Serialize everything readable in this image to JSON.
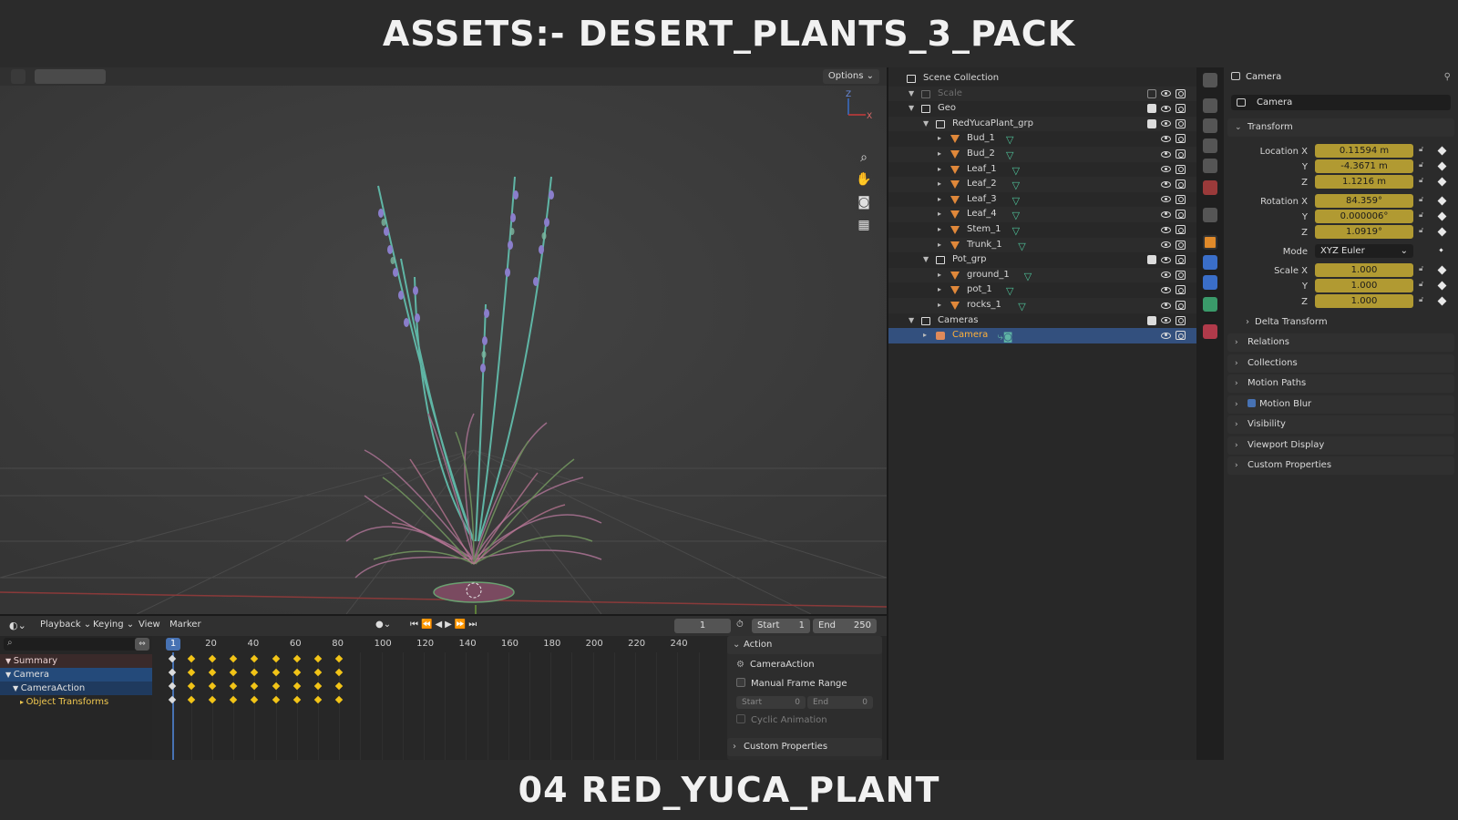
{
  "banner": {
    "title": "ASSETS:- DESERT_PLANTS_3_PACK",
    "subtitle": "04 RED_YUCA_PLANT"
  },
  "viewport": {
    "options_label": "Options",
    "gizmo_axes": [
      "Z",
      "X"
    ]
  },
  "outliner": {
    "rows": [
      {
        "label": "Scene Collection",
        "indent": 0,
        "kind": "collection"
      },
      {
        "label": "Scale",
        "indent": 1,
        "kind": "collection",
        "muted": true
      },
      {
        "label": "Geo",
        "indent": 1,
        "kind": "collection"
      },
      {
        "label": "RedYucaPlant_grp",
        "indent": 2,
        "kind": "collection"
      },
      {
        "label": "Bud_1",
        "indent": 3,
        "kind": "mesh"
      },
      {
        "label": "Bud_2",
        "indent": 3,
        "kind": "mesh"
      },
      {
        "label": "Leaf_1",
        "indent": 3,
        "kind": "mesh"
      },
      {
        "label": "Leaf_2",
        "indent": 3,
        "kind": "mesh"
      },
      {
        "label": "Leaf_3",
        "indent": 3,
        "kind": "mesh"
      },
      {
        "label": "Leaf_4",
        "indent": 3,
        "kind": "mesh"
      },
      {
        "label": "Stem_1",
        "indent": 3,
        "kind": "mesh"
      },
      {
        "label": "Trunk_1",
        "indent": 3,
        "kind": "mesh"
      },
      {
        "label": "Pot_grp",
        "indent": 2,
        "kind": "collection"
      },
      {
        "label": "ground_1",
        "indent": 3,
        "kind": "mesh"
      },
      {
        "label": "pot_1",
        "indent": 3,
        "kind": "mesh"
      },
      {
        "label": "rocks_1",
        "indent": 3,
        "kind": "mesh"
      },
      {
        "label": "Cameras",
        "indent": 1,
        "kind": "collection"
      },
      {
        "label": "Camera",
        "indent": 2,
        "kind": "camera",
        "selected": true
      }
    ]
  },
  "properties": {
    "object_name": "Camera",
    "object_field": "Camera",
    "transform_label": "Transform",
    "location": {
      "label": "Location X",
      "x": "0.11594 m",
      "y": "-4.3671 m",
      "z": "1.1216 m"
    },
    "rotation": {
      "label": "Rotation X",
      "x": "84.359°",
      "y": "0.000006°",
      "z": "1.0919°"
    },
    "mode_label": "Mode",
    "mode_value": "XYZ Euler",
    "scale": {
      "label": "Scale X",
      "x": "1.000",
      "y": "1.000",
      "z": "1.000"
    },
    "axis_y": "Y",
    "axis_z": "Z",
    "delta_transform": "Delta Transform",
    "sections": [
      "Relations",
      "Collections",
      "Motion Paths",
      "Motion Blur",
      "Visibility",
      "Viewport Display",
      "Custom Properties"
    ]
  },
  "timeline": {
    "menus": [
      "Playback",
      "Keying",
      "View",
      "Marker"
    ],
    "current_frame": "1",
    "start_label": "Start",
    "start_value": "1",
    "end_label": "End",
    "end_value": "250",
    "ruler": [
      "1",
      "20",
      "40",
      "60",
      "80",
      "100",
      "120",
      "140",
      "160",
      "180",
      "200",
      "220",
      "240"
    ],
    "channels": [
      {
        "label": "Summary",
        "type": "summary"
      },
      {
        "label": "Camera",
        "type": "object"
      },
      {
        "label": "CameraAction",
        "type": "action"
      },
      {
        "label": "Object Transforms",
        "type": "group"
      }
    ],
    "keyframes": [
      1,
      10,
      20,
      30,
      40,
      50,
      60,
      70,
      80
    ]
  },
  "action_panel": {
    "title": "Action",
    "action_name": "CameraAction",
    "manual_frame_range": "Manual Frame Range",
    "start_label": "Start",
    "start_value": "0",
    "end_label": "End",
    "end_value": "0",
    "cyclic": "Cyclic Animation",
    "custom_props": "Custom Properties"
  },
  "colors": {
    "accent": "#4772b3",
    "keyframe": "#f2c417",
    "selected_text": "#ffb13b",
    "field_animated": "#b19a32"
  }
}
